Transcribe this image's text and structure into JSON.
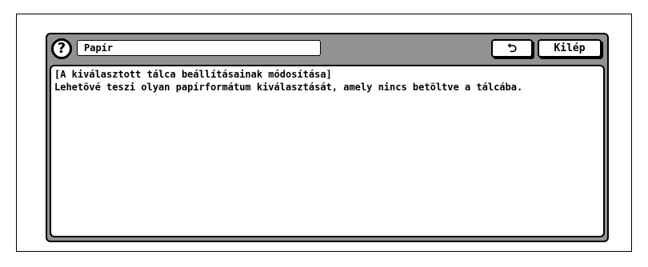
{
  "header": {
    "help_icon": "question-mark-icon",
    "title": "Papír",
    "back_icon": "return-arrow-icon",
    "back_symbol": "⮌",
    "exit_label": "Kilép"
  },
  "content": {
    "heading": "[A kiválasztott tálca beállításainak módosítása]",
    "body": "Lehetövé teszi olyan papírformátum kiválasztását, amely nincs betöltve a tálcába."
  }
}
